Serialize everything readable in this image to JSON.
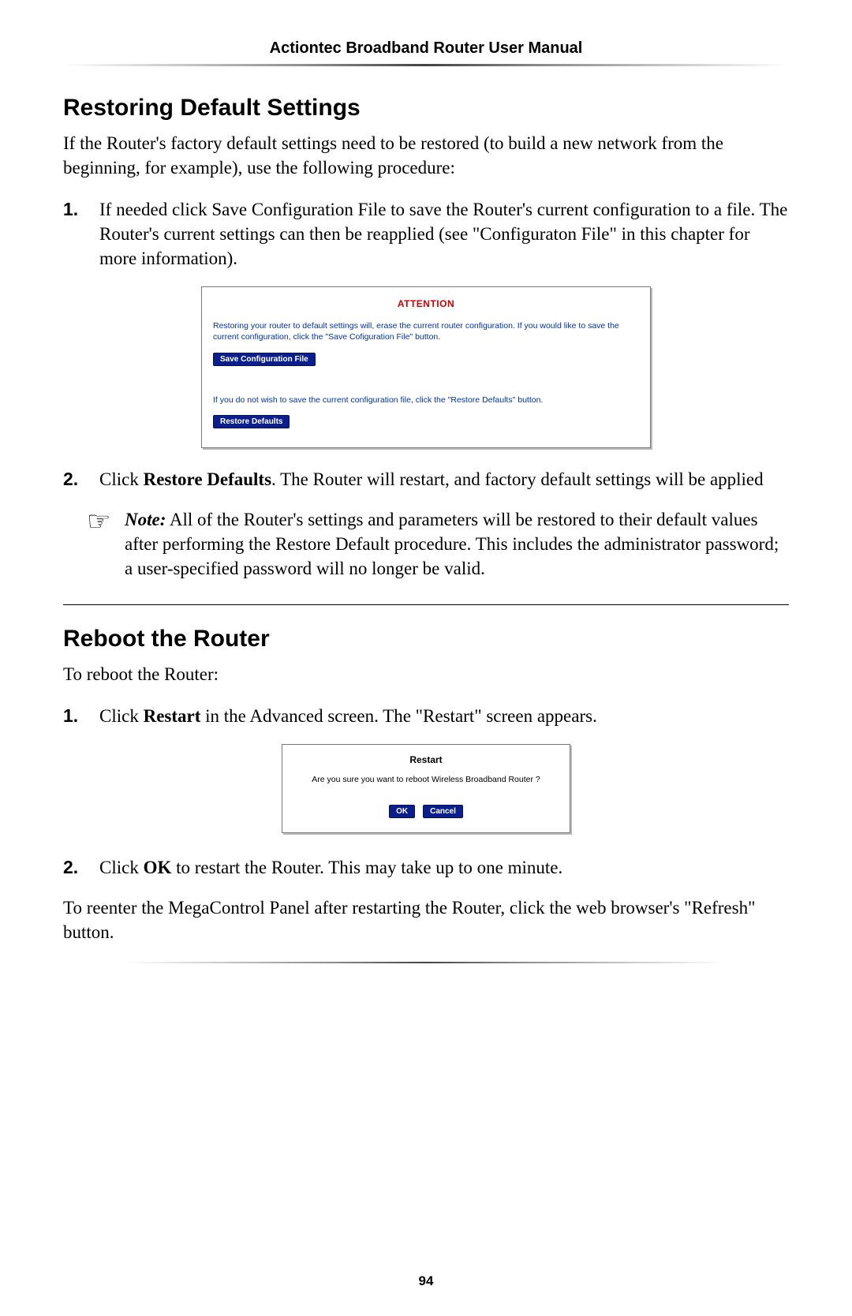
{
  "header": {
    "title": "Actiontec Broadband Router User Manual"
  },
  "section1": {
    "heading": "Restoring Default Settings",
    "intro": "If the Router's factory default settings need to be restored (to build a new network from the beginning, for example), use the following procedure:",
    "step1_num": "1.",
    "step1_text": "If needed click Save Configuration File to save the Router's current configuration to a file. The Router's current settings can then be reapplied (see \"Configuraton File\" in this chapter for more information).",
    "panel": {
      "title": "ATTENTION",
      "msg1": "Restoring your router to default settings will, erase the current router configuration. If you would like to save the current configuration, click the \"Save Cofiguration File\" button.",
      "btn1": "Save Configuration File",
      "msg2": "If you do not wish to save the current configuration file, click the \"Restore Defaults\" button.",
      "btn2": "Restore Defaults"
    },
    "step2_num": "2.",
    "step2_prefix": "Click ",
    "step2_bold": "Restore Defaults",
    "step2_suffix": ". The Router will restart, and factory default settings will be applied",
    "note_label": "Note:",
    "note_text": " All of the Router's settings and parameters will be restored to their default values after performing the Restore Default procedure. This includes the administrator password; a user-specified password will no longer be valid."
  },
  "section2": {
    "heading": "Reboot the Router",
    "intro": "To reboot the Router:",
    "step1_num": "1.",
    "step1_prefix": "Click ",
    "step1_bold": "Restart",
    "step1_suffix": " in the Advanced screen. The \"Restart\" screen appears.",
    "panel": {
      "title": "Restart",
      "msg": "Are you sure you want to reboot Wireless Broadband Router ?",
      "ok": "OK",
      "cancel": "Cancel"
    },
    "step2_num": "2.",
    "step2_prefix": "Click ",
    "step2_bold": "OK",
    "step2_suffix": " to restart the Router. This may take up to one minute.",
    "outro": "To reenter the MegaControl Panel after restarting the Router, click the web browser's \"Refresh\" button."
  },
  "footer": {
    "page": "94"
  }
}
